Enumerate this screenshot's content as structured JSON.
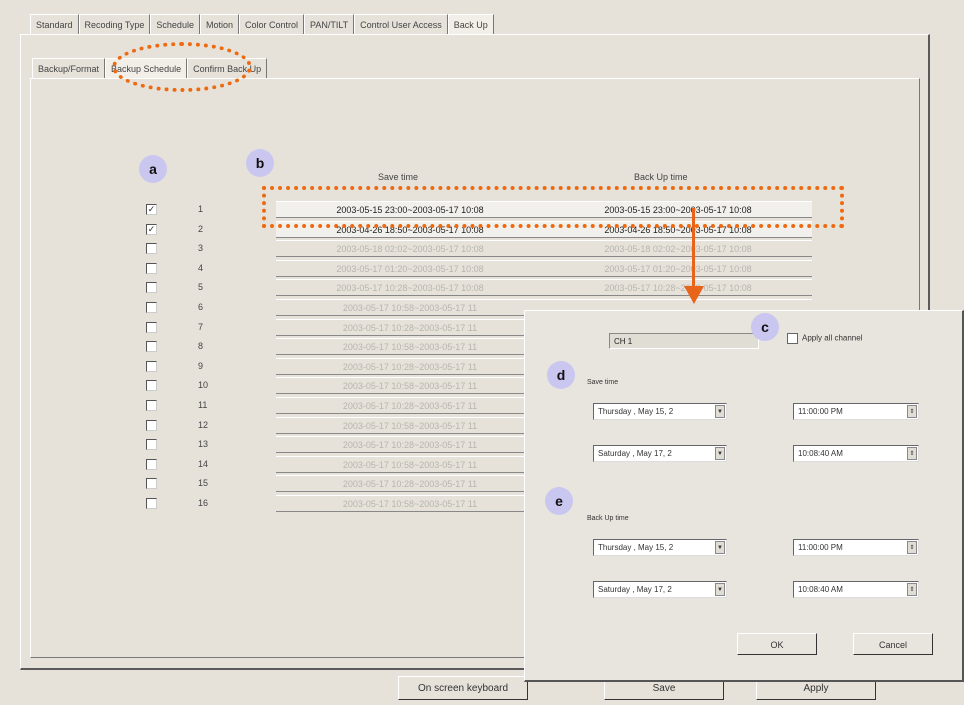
{
  "tabs": [
    "Standard",
    "Recoding Type",
    "Schedule",
    "Motion",
    "Color Control",
    "PAN/TILT",
    "Control User Access",
    "Back Up"
  ],
  "subtabs": [
    "Backup/Format",
    "Backup Schedule",
    "Confirm Back Up"
  ],
  "labels": {
    "a": "a",
    "b": "b",
    "c": "c",
    "d": "d",
    "e": "e"
  },
  "columns": {
    "save_time": "Save time",
    "backup_time": "Back Up time"
  },
  "rows": [
    {
      "num": "1",
      "checked": "✓",
      "save": "2003-05-15 23:00~2003-05-17 10:08",
      "backup": "2003-05-15 23:00~2003-05-17 10:08"
    },
    {
      "num": "2",
      "checked": "✓",
      "save": "2003-04-26 18:50~2003-05-17 10:08",
      "backup": "2003-04-26 18:50~2003-05-17 10:08"
    },
    {
      "num": "3",
      "checked": "",
      "save": "2003-05-18 02:02~2003-05-17 10:08",
      "backup": "2003-05-18 02:02~2003-05-17 10:08"
    },
    {
      "num": "4",
      "checked": "",
      "save": "2003-05-17 01:20~2003-05-17 10:08",
      "backup": "2003-05-17 01:20~2003-05-17 10:08"
    },
    {
      "num": "5",
      "checked": "",
      "save": "2003-05-17 10:28~2003-05-17 10:08",
      "backup": "2003-05-17 10:28~2003-05-17 10:08"
    },
    {
      "num": "6",
      "checked": "",
      "save": "2003-05-17 10:58~2003-05-17 11",
      "backup": ""
    },
    {
      "num": "7",
      "checked": "",
      "save": "2003-05-17 10:28~2003-05-17 11",
      "backup": ""
    },
    {
      "num": "8",
      "checked": "",
      "save": "2003-05-17 10:58~2003-05-17 11",
      "backup": ""
    },
    {
      "num": "9",
      "checked": "",
      "save": "2003-05-17 10:28~2003-05-17 11",
      "backup": ""
    },
    {
      "num": "10",
      "checked": "",
      "save": "2003-05-17 10:58~2003-05-17 11",
      "backup": ""
    },
    {
      "num": "11",
      "checked": "",
      "save": "2003-05-17 10:28~2003-05-17 11",
      "backup": ""
    },
    {
      "num": "12",
      "checked": "",
      "save": "2003-05-17 10:58~2003-05-17 11",
      "backup": ""
    },
    {
      "num": "13",
      "checked": "",
      "save": "2003-05-17 10:28~2003-05-17 11",
      "backup": ""
    },
    {
      "num": "14",
      "checked": "",
      "save": "2003-05-17 10:58~2003-05-17 11",
      "backup": ""
    },
    {
      "num": "15",
      "checked": "",
      "save": "2003-05-17 10:28~2003-05-17 11",
      "backup": ""
    },
    {
      "num": "16",
      "checked": "",
      "save": "2003-05-17 10:58~2003-05-17 11",
      "backup": ""
    }
  ],
  "bottom_buttons": {
    "keyboard": "On screen keyboard",
    "save": "Save",
    "apply": "Apply"
  },
  "dialog": {
    "channel": "CH 1",
    "apply_all": "Apply all channel",
    "save_time_label": "Save time",
    "backup_time_label": "Back Up time",
    "save_start_date": "Thursday ,   May   15, 2",
    "save_start_time": "11:00:00 PM",
    "save_end_date": "Saturday ,   May   17, 2",
    "save_end_time": "10:08:40 AM",
    "backup_start_date": "Thursday ,   May   15, 2",
    "backup_start_time": "11:00:00 PM",
    "backup_end_date": "Saturday ,   May   17, 2",
    "backup_end_time": "10:08:40 AM",
    "ok": "OK",
    "cancel": "Cancel"
  },
  "colors": {
    "highlight": "#ee6a10",
    "tag": "#c9c6f0",
    "window": "#e6e2da"
  }
}
